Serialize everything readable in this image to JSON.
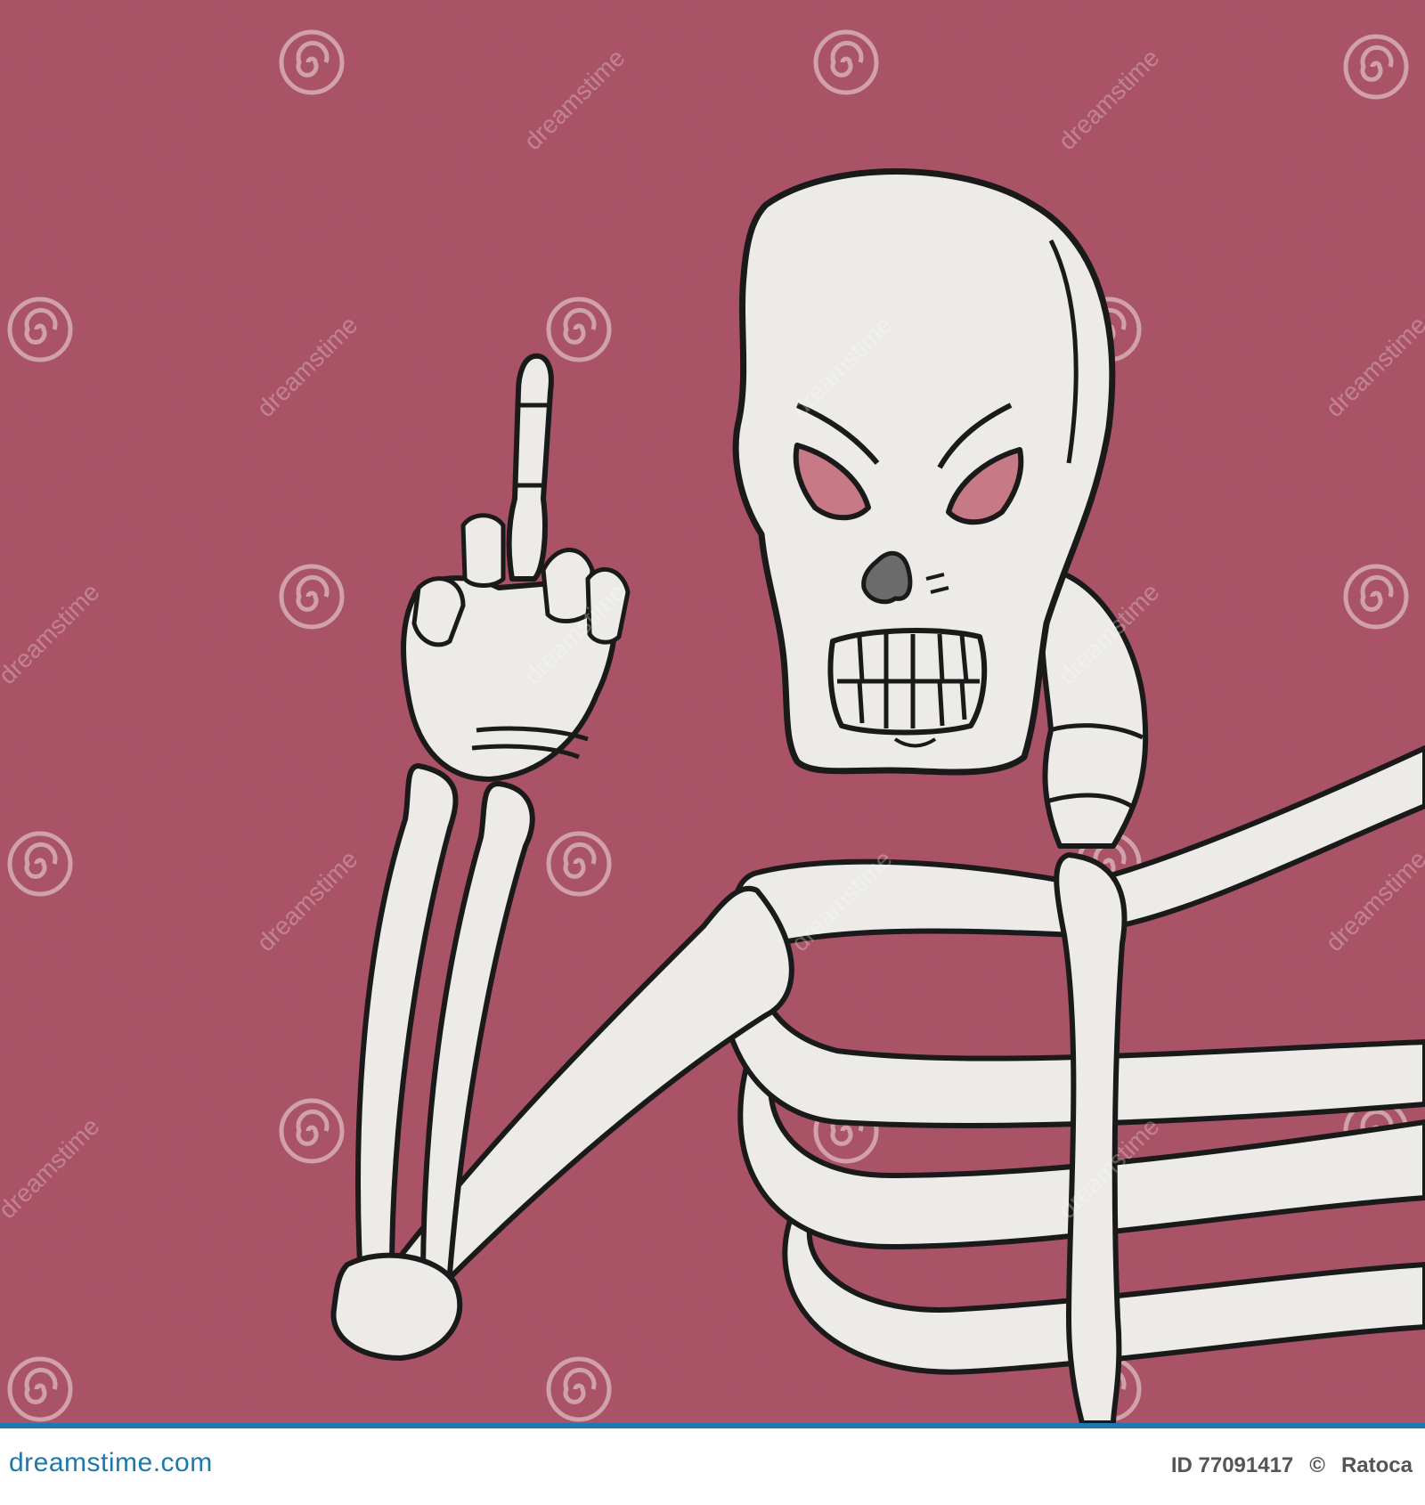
{
  "image": {
    "background_color": "#ab5468",
    "bone_color": "#ecebe8",
    "outline_color": "#1a1a1a",
    "eye_color": "#c77a86",
    "nose_color": "#6b6b6b"
  },
  "watermark": {
    "text": "dreamstime",
    "icon": "spiral-logo-icon"
  },
  "footer": {
    "brand": "dreamstime.com",
    "id_label": "ID 77091417",
    "bullet": "©",
    "author": "Ratoca",
    "accent_color": "#1b79ad"
  }
}
